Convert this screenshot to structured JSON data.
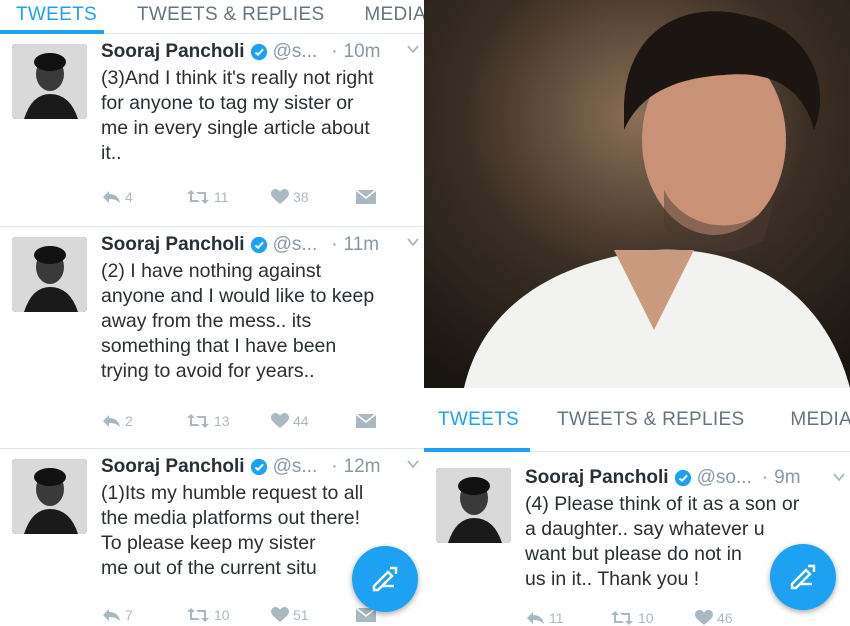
{
  "tabs": [
    "TWEETS",
    "TWEETS & REPLIES",
    "MEDIA"
  ],
  "left_tweets": [
    {
      "name": "Sooraj Pancholi",
      "handle": "@s...",
      "dot": "·",
      "time": "10m",
      "lines": [
        "(3)And I think it's really not right",
        "for anyone to tag my sister or",
        "me in every single article about",
        "it.."
      ],
      "replies": "4",
      "retweets": "11",
      "likes": "38"
    },
    {
      "name": "Sooraj Pancholi",
      "handle": "@s...",
      "dot": "·",
      "time": "11m",
      "lines": [
        "(2) I have nothing against",
        "anyone and I would like to keep",
        "away from the mess.. its",
        "something that I have been",
        "trying to avoid for years.."
      ],
      "replies": "2",
      "retweets": "13",
      "likes": "44"
    },
    {
      "name": "Sooraj Pancholi",
      "handle": "@s...",
      "dot": "·",
      "time": "12m",
      "lines": [
        "(1)Its my humble request to all",
        "the media platforms out there!",
        "To please keep my sister",
        "me out of the current situ"
      ],
      "replies": "7",
      "retweets": "10",
      "likes": "51"
    }
  ],
  "right_tweet": {
    "name": "Sooraj Pancholi",
    "handle": "@so...",
    "dot": "·",
    "time": "9m",
    "lines": [
      "(4) Please think of it as a son or",
      "a daughter.. say whatever u",
      "want but please do not in",
      "us in it.. Thank you !"
    ],
    "replies": "11",
    "retweets": "10",
    "likes": "46"
  },
  "colors": {
    "accent": "#1da1f2",
    "muted": "#8899a6",
    "text": "#292f33"
  },
  "icons": [
    "verified-badge-icon",
    "chevron-down-icon",
    "reply-icon",
    "retweet-icon",
    "heart-icon",
    "direct-message-icon",
    "compose-tweet-icon"
  ]
}
